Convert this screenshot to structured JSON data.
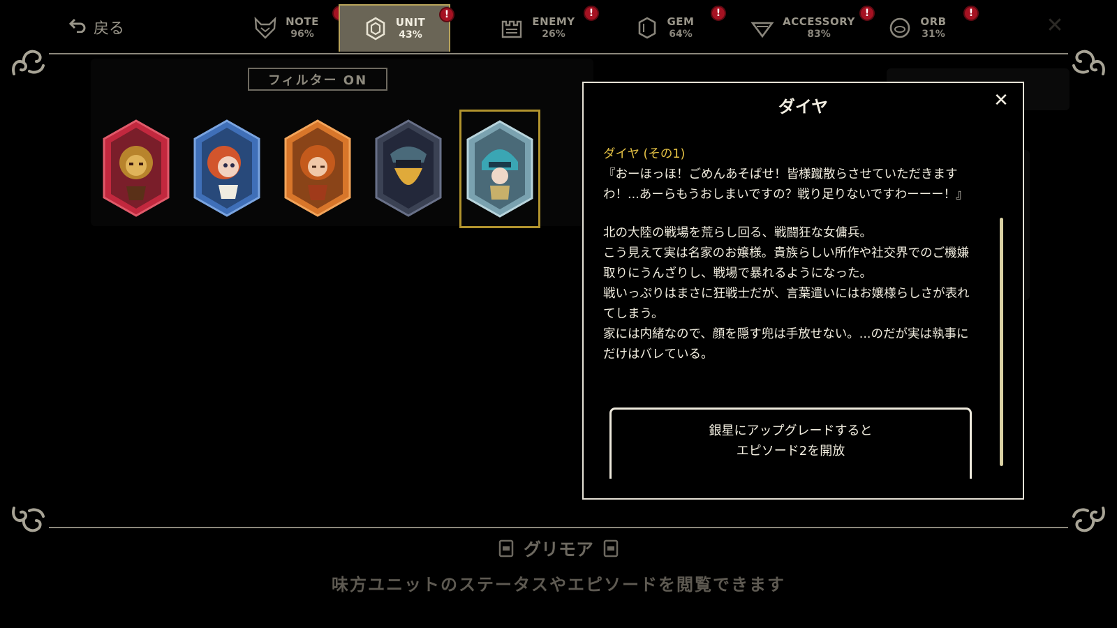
{
  "nav": {
    "back_label": "戻る",
    "tabs": [
      {
        "name": "NOTE",
        "percent": "96%",
        "icon": "fox-icon",
        "alert": "!"
      },
      {
        "name": "UNIT",
        "percent": "43%",
        "icon": "hexagon-gem-icon",
        "alert": "!",
        "active": true
      },
      {
        "name": "ENEMY",
        "percent": "26%",
        "icon": "castle-icon",
        "alert": "!"
      },
      {
        "name": "GEM",
        "percent": "64%",
        "icon": "gem-icon",
        "alert": "!"
      },
      {
        "name": "ACCESSORY",
        "percent": "83%",
        "icon": "pendant-icon",
        "alert": "!"
      },
      {
        "name": "ORB",
        "percent": "31%",
        "icon": "orb-icon",
        "alert": "!"
      }
    ],
    "close_glyph": "✕"
  },
  "filter": {
    "label": "フィルター ON"
  },
  "units": [
    {
      "color": "#c2283e",
      "icon": "lion-warrior-portrait"
    },
    {
      "color": "#3f6fb8",
      "icon": "red-haired-girl-portrait"
    },
    {
      "color": "#d8762a",
      "icon": "orange-haired-girl-portrait"
    },
    {
      "color": "#3b4254",
      "icon": "masked-bearded-man-portrait"
    },
    {
      "color": "#7aa2b0",
      "icon": "helmeted-knight-girl-portrait",
      "selected": true
    }
  ],
  "modal": {
    "title": "ダイヤ",
    "close_glyph": "✕",
    "episode_title": "ダイヤ (その1)",
    "quote": "『おーほっほ！ごめんあそばせ！皆様蹴散らさせていただきますわ！...あーらもうおしまいですの？戦り足りないですわーーー！』",
    "lines": [
      "北の大陸の戦場を荒らし回る、戦闘狂な女傭兵。",
      "こう見えて実は名家のお嬢様。貴族らしい所作や社交界でのご機嫌取りにうんざりし、戦場で暴れるようになった。",
      "戦いっぷりはまさに狂戦士だが、言葉遣いにはお嬢様らしさが表れてしまう。",
      "家には内緒なので、顔を隠す兜は手放せない。...のだが実は執事にだけはバレている。"
    ],
    "unlock_line1": "銀星にアップグレードすると",
    "unlock_line2": "エピソード2を開放"
  },
  "footer": {
    "title": "グリモア",
    "description": "味方ユニットのステータスやエピソードを閲覧できます"
  }
}
